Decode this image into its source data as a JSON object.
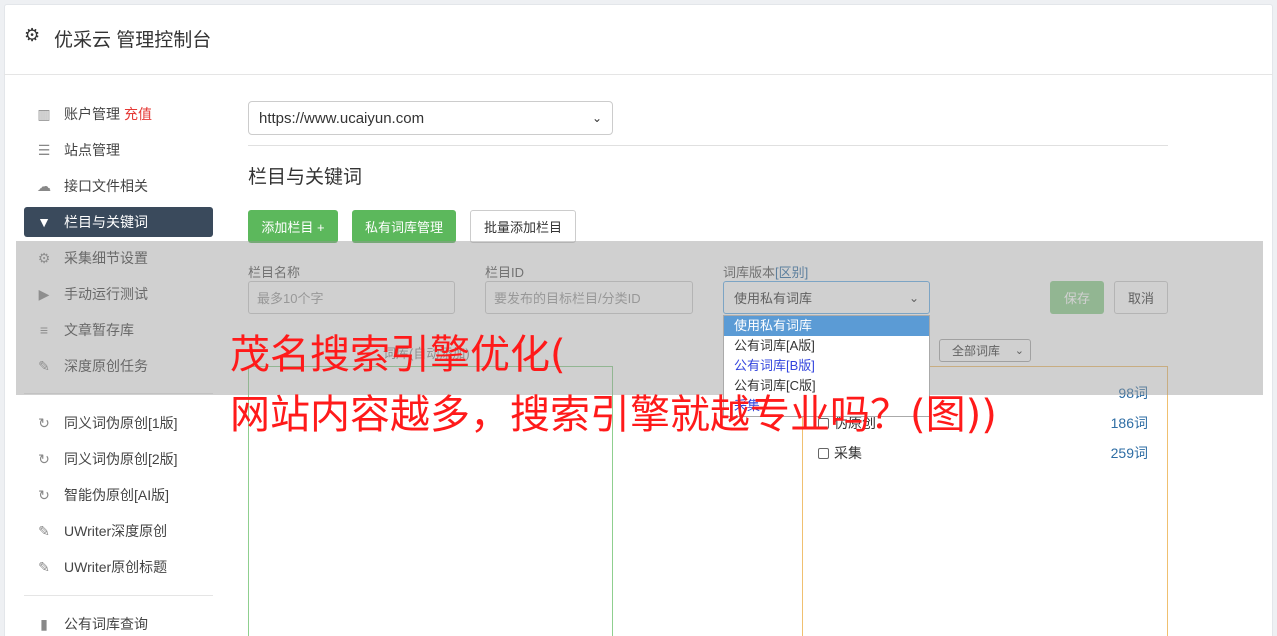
{
  "header": {
    "title": "优采云 管理控制台",
    "icon": "gear-icon"
  },
  "sidebar": {
    "items": [
      {
        "label": "账户管理",
        "badge": "充值",
        "icon": "bar-chart-icon"
      },
      {
        "label": "站点管理",
        "icon": "server-icon"
      },
      {
        "label": "接口文件相关",
        "icon": "cloud-upload-icon"
      },
      {
        "label": "栏目与关键词",
        "icon": "filter-icon",
        "active": true
      },
      {
        "label": "采集细节设置",
        "icon": "cogs-icon"
      },
      {
        "label": "手动运行测试",
        "icon": "play-icon"
      },
      {
        "label": "文章暂存库",
        "icon": "database-icon"
      },
      {
        "label": "深度原创任务",
        "icon": "edit-icon"
      },
      {
        "label": "同义词伪原创[1版]",
        "icon": "refresh-icon"
      },
      {
        "label": "同义词伪原创[2版]",
        "icon": "refresh-icon"
      },
      {
        "label": "智能伪原创[AI版]",
        "icon": "refresh-icon"
      },
      {
        "label": "UWriter深度原创",
        "icon": "edit-icon"
      },
      {
        "label": "UWriter原创标题",
        "icon": "edit-icon"
      },
      {
        "label": "公有词库查询",
        "icon": "book-icon"
      }
    ]
  },
  "main": {
    "site_select": "https://www.ucaiyun.com",
    "section_title": "栏目与关键词",
    "buttons": {
      "add_column": "添加栏目 +",
      "private_lib": "私有词库管理",
      "batch_add": "批量添加栏目"
    },
    "form": {
      "name_label": "栏目名称",
      "name_placeholder": "最多10个字",
      "id_label": "栏目ID",
      "id_placeholder": "要发布的目标栏目/分类ID",
      "lib_label": "词库版本",
      "lib_link": "[区别]",
      "lib_selected": "使用私有词库",
      "save": "保存",
      "cancel": "取消"
    },
    "lib_options": [
      "使用私有词库",
      "公有词库[A版]",
      "公有词库[B版]",
      "公有词库[C版]",
      "采集"
    ],
    "lib_hint": "词库(自动添加)",
    "filter_select": "全部词库",
    "keywords": [
      {
        "label": "",
        "count": "98词"
      },
      {
        "label": "伪原创",
        "count": "186词"
      },
      {
        "label": "采集",
        "count": "259词"
      }
    ]
  },
  "banner": {
    "line1": "茂名搜索引擎优化(",
    "line2": "网站内容越多，搜索引擎就越专业吗？(图))"
  },
  "colors": {
    "accent_green": "#5cb85c",
    "active_bg": "#3a4a5c",
    "banner_red": "#ff1a1a"
  }
}
